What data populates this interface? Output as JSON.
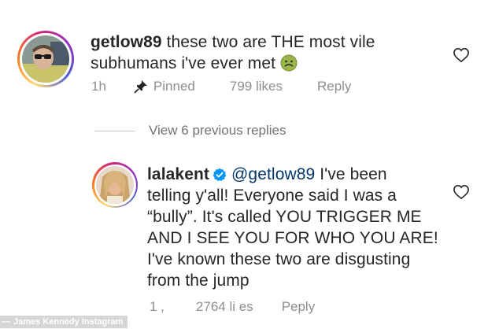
{
  "comment1": {
    "username": "getlow89",
    "text_line1": "these two are THE most vile",
    "text_line2": "subhumans i've ever met",
    "emoji": "🤢",
    "time": "1h",
    "pinned_label": "Pinned",
    "likes": "799 likes",
    "reply_label": "Reply"
  },
  "view_replies_label": "View 6 previous replies",
  "comment2": {
    "username": "lalakent",
    "mention": "@getlow89",
    "line1_rest": "I've been",
    "line2": "telling y'all! Everyone said I was a",
    "line3": "“bully”. It's called YOU TRIGGER ME",
    "line4": "AND I SEE YOU FOR WHO YOU ARE!",
    "line5": "I've known these two are disgusting",
    "line6": "from the jump",
    "time": "1 ,",
    "likes": "2764 li es",
    "reply_label": "Peply"
  },
  "credit": "James Kennedy Instagram",
  "colors": {
    "text": "#262626",
    "meta": "#8e8e8e",
    "mention": "#00376b",
    "verified": "#0095f6"
  }
}
